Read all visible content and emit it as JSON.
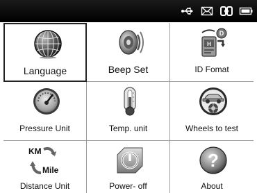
{
  "status_icons": [
    "usb-icon",
    "mail-icon",
    "link-icon",
    "battery-icon"
  ],
  "menu": {
    "items": [
      {
        "id": "language",
        "label": "Language",
        "icon": "globe-icon",
        "selected": true
      },
      {
        "id": "beep-set",
        "label": "Beep Set",
        "icon": "speaker-icon",
        "selected": false
      },
      {
        "id": "id-fomat",
        "label": "ID Fomat",
        "icon": "id-format-icon",
        "selected": false
      },
      {
        "id": "pressure-unit",
        "label": "Pressure Unit",
        "icon": "gauge-icon",
        "selected": false
      },
      {
        "id": "temp-unit",
        "label": "Temp. unit",
        "icon": "thermometer-icon",
        "selected": false
      },
      {
        "id": "wheels-to-test",
        "label": "Wheels to test",
        "icon": "car-wheel-icon",
        "selected": false
      },
      {
        "id": "distance-unit",
        "label": "Distance Unit",
        "icon": "km-mile-icon",
        "selected": false
      },
      {
        "id": "power-off",
        "label": "Power- off",
        "icon": "power-icon",
        "selected": false
      },
      {
        "id": "about",
        "label": "About",
        "icon": "question-icon",
        "selected": false
      }
    ],
    "icon_texts": {
      "km": "KM",
      "mile": "Mile"
    }
  },
  "colors": {
    "statusbar": "#000000",
    "text": "#111111",
    "grid_line": "#9a9a9a"
  }
}
